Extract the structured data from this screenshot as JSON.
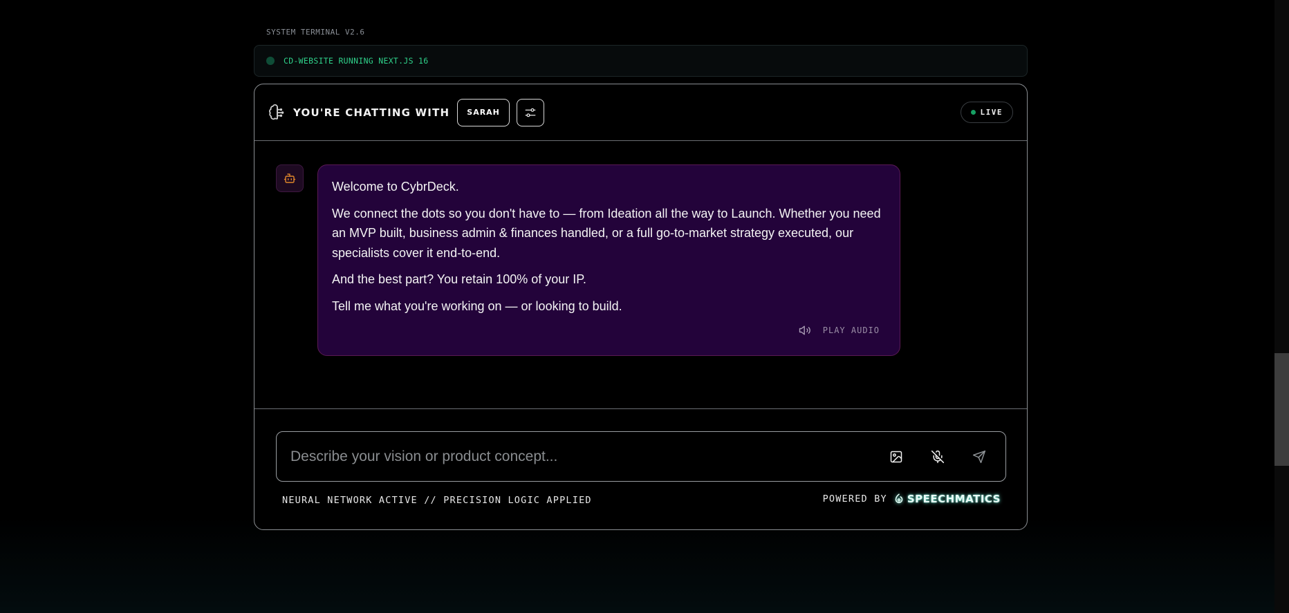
{
  "header": {
    "system_label": "SYSTEM TERMINAL V2.6",
    "status_text": "CD-WEBSITE RUNNING NEXT.JS 16"
  },
  "chat": {
    "title": "YOU'RE CHATTING WITH",
    "persona": "SARAH",
    "live_label": "LIVE"
  },
  "message": {
    "paragraphs": [
      "Welcome to CybrDeck.",
      "We connect the dots so you don't have to — from Ideation all the way to Launch. Whether you need an MVP built, business admin & finances handled, or a full go-to-market strategy executed, our specialists cover it end-to-end.",
      "And the best part? You retain 100% of your IP.",
      "Tell me what you're working on — or looking to build."
    ],
    "audio_label": "PLAY AUDIO"
  },
  "composer": {
    "placeholder": "Describe your vision or product concept...",
    "value": ""
  },
  "footer": {
    "left_text": "NEURAL NETWORK ACTIVE // PRECISION LOGIC APPLIED",
    "powered_by": "POWERED BY",
    "brand": "SPEECHMATICS"
  },
  "colors": {
    "accent_green": "#2fd18a",
    "bubble_bg": "#23033a",
    "bot_icon": "#e0872a"
  }
}
